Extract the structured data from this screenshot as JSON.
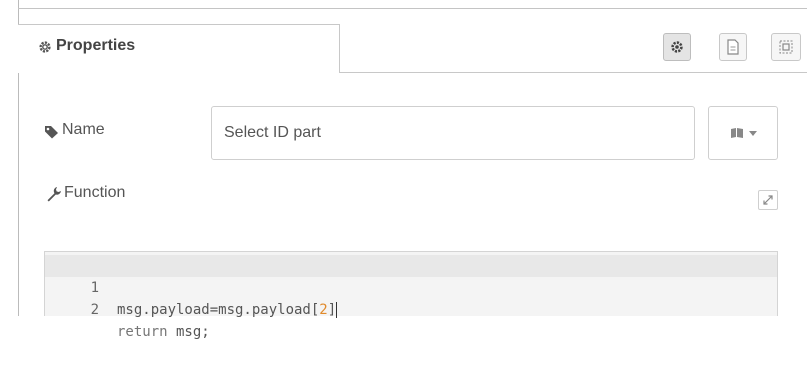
{
  "tab": {
    "label": "Properties"
  },
  "toolbar": {
    "settings_icon": "gear-icon",
    "description_icon": "document-icon",
    "appearance_icon": "frame-icon"
  },
  "name": {
    "label": "Name",
    "value": "Select ID part",
    "button_icon": "book-icon"
  },
  "function": {
    "label": "Function",
    "expand_icon": "expand-icon",
    "code_lines": [
      {
        "number": "1",
        "text": "msg.payload=msg.payload[2]"
      },
      {
        "number": "2",
        "text": "return msg;"
      }
    ]
  }
}
